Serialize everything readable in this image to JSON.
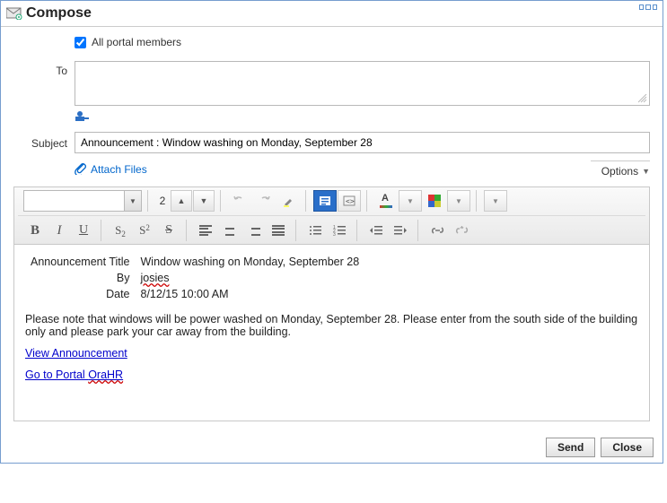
{
  "window": {
    "title": "Compose"
  },
  "form": {
    "all_members_label": "All portal members",
    "all_members_checked": "true",
    "to_label": "To",
    "subject_label": "Subject",
    "subject_value": "Announcement : Window washing on Monday, September 28",
    "attach_label": "Attach Files",
    "options_label": "Options"
  },
  "toolbar": {
    "font_size": "2"
  },
  "announcement": {
    "title_label": "Announcement Title",
    "title_value": "Window washing on Monday, September 28",
    "by_label": "By",
    "by_value": "josies",
    "date_label": "Date",
    "date_value": "8/12/15 10:00 AM",
    "body": "Please note that windows will be power washed on Monday, September 28. Please enter from the south side of the building only and please park your car away from the building.",
    "view_link": "View Announcement",
    "portal_link_prefix": "Go to Portal ",
    "portal_link_name": "OraHR"
  },
  "footer": {
    "send": "Send",
    "close": "Close"
  }
}
